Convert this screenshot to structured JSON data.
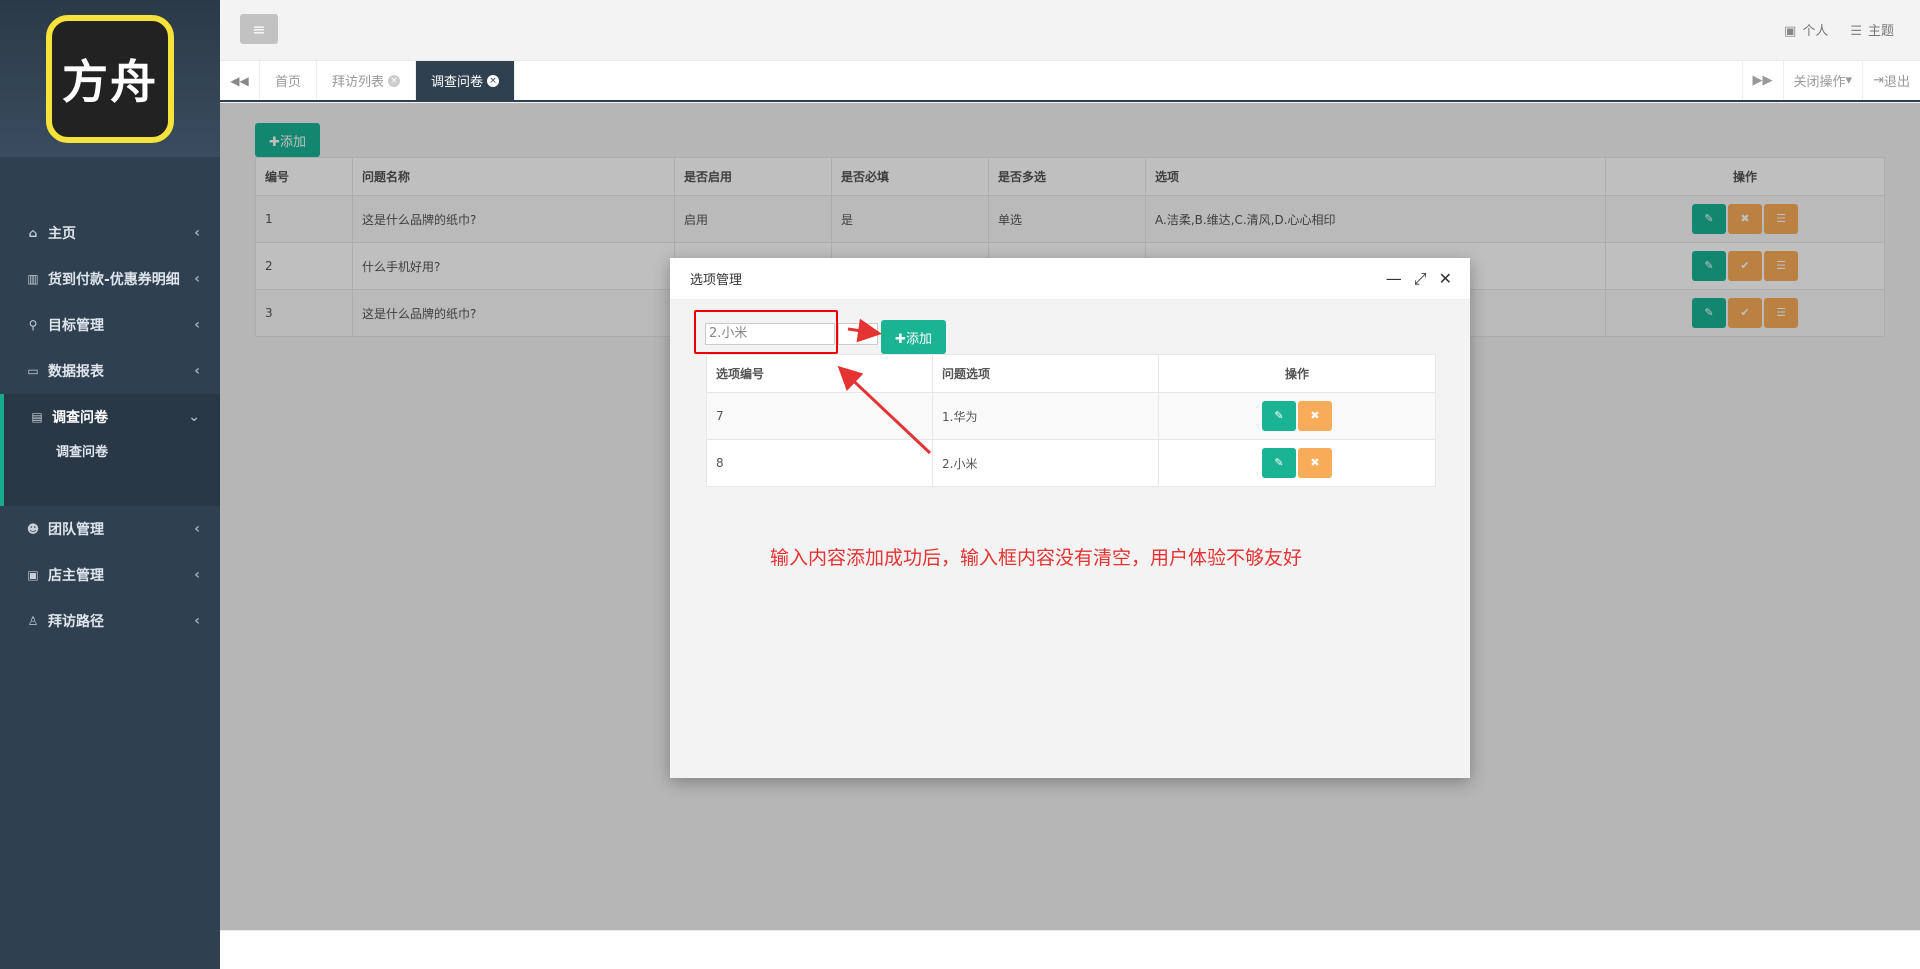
{
  "sidebar": {
    "logo_text": "方舟",
    "items": [
      {
        "label": "主页",
        "icon": "home-icon"
      },
      {
        "label": "货到付款-优惠券明细",
        "icon": "bank-icon"
      },
      {
        "label": "目标管理",
        "icon": "walk-icon"
      },
      {
        "label": "数据报表",
        "icon": "rectangle-icon"
      },
      {
        "label": "调查问卷",
        "icon": "chart-icon"
      },
      {
        "label": "团队管理",
        "icon": "users-icon"
      },
      {
        "label": "店主管理",
        "icon": "id-card-icon"
      },
      {
        "label": "拜访路径",
        "icon": "child-icon"
      }
    ],
    "sub_item": "调查问卷"
  },
  "topbar": {
    "personal": "个人",
    "theme": "主题"
  },
  "tabs": {
    "items": [
      "首页",
      "拜访列表",
      "调查问卷"
    ],
    "close_ops": "关闭操作",
    "logout": "退出"
  },
  "main": {
    "add_label": "✚添加",
    "columns": [
      "编号",
      "问题名称",
      "是否启用",
      "是否必填",
      "是否多选",
      "选项",
      "操作"
    ],
    "rows": [
      {
        "id": "1",
        "name": "这是什么品牌的纸巾?",
        "enabled": "启用",
        "required": "是",
        "multi": "单选",
        "options": "A.洁柔,B.维达,C.清风,D.心心相印"
      },
      {
        "id": "2",
        "name": "什么手机好用?",
        "enabled": "",
        "required": "",
        "multi": "",
        "options": ""
      },
      {
        "id": "3",
        "name": "这是什么品牌的纸巾?",
        "enabled": "",
        "required": "",
        "multi": "",
        "options": ""
      }
    ]
  },
  "modal": {
    "title": "选项管理",
    "input_value": "2.小米",
    "add_label": "✚添加",
    "columns": [
      "选项编号",
      "问题选项",
      "操作"
    ],
    "rows": [
      {
        "id": "7",
        "option": "1.华为"
      },
      {
        "id": "8",
        "option": "2.小米"
      }
    ],
    "note": "输入内容添加成功后，输入框内容没有清空，用户体验不够友好"
  },
  "colors": {
    "sidebar": "#2f4050",
    "primary": "#1ab394",
    "warning": "#f8ac59",
    "annotation": "#e53333"
  }
}
